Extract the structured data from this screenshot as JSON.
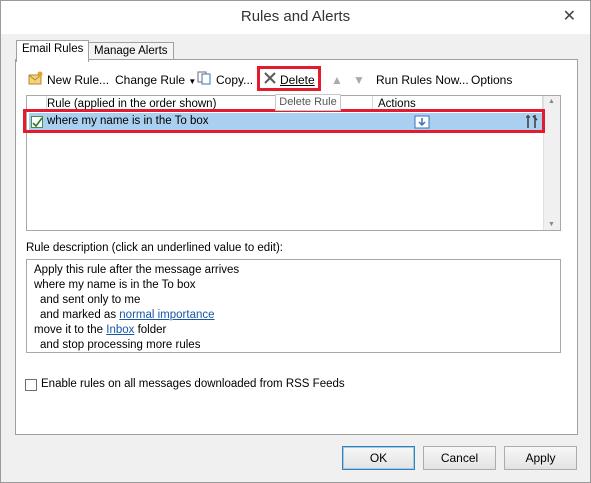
{
  "window": {
    "title": "Rules and Alerts",
    "close_glyph": "✕"
  },
  "tabs": [
    {
      "label": "Email Rules",
      "active": true
    },
    {
      "label": "Manage Alerts",
      "active": false
    }
  ],
  "toolbar": {
    "new_rule": "New Rule...",
    "change_rule": "Change Rule",
    "copy": "Copy...",
    "delete": "Delete",
    "run_rules_now": "Run Rules Now...",
    "options": "Options",
    "tooltip": "Delete Rule"
  },
  "rules_list": {
    "columns": {
      "rule": "Rule (applied in the order shown)",
      "actions": "Actions"
    },
    "rows": [
      {
        "name": "where my name is in the To box",
        "enabled": true
      }
    ]
  },
  "description": {
    "label": "Rule description (click an underlined value to edit):",
    "lines": {
      "l1": "Apply this rule after the message arrives",
      "l2": "where my name is in the To box",
      "l3": "and sent only to me",
      "l4_prefix": "and marked as",
      "l4_link": "normal importance",
      "l5_prefix": "move it to the",
      "l5_link": "Inbox",
      "l5_suffix": "folder",
      "l6": "and stop processing more rules"
    }
  },
  "rss_checkbox": {
    "label": "Enable rules on all messages downloaded from RSS Feeds",
    "checked": false
  },
  "buttons": {
    "ok": "OK",
    "cancel": "Cancel",
    "apply": "Apply"
  },
  "colors": {
    "accent_red": "#e21b2d",
    "selection": "#a9d0f0",
    "link": "#1a56a8"
  }
}
